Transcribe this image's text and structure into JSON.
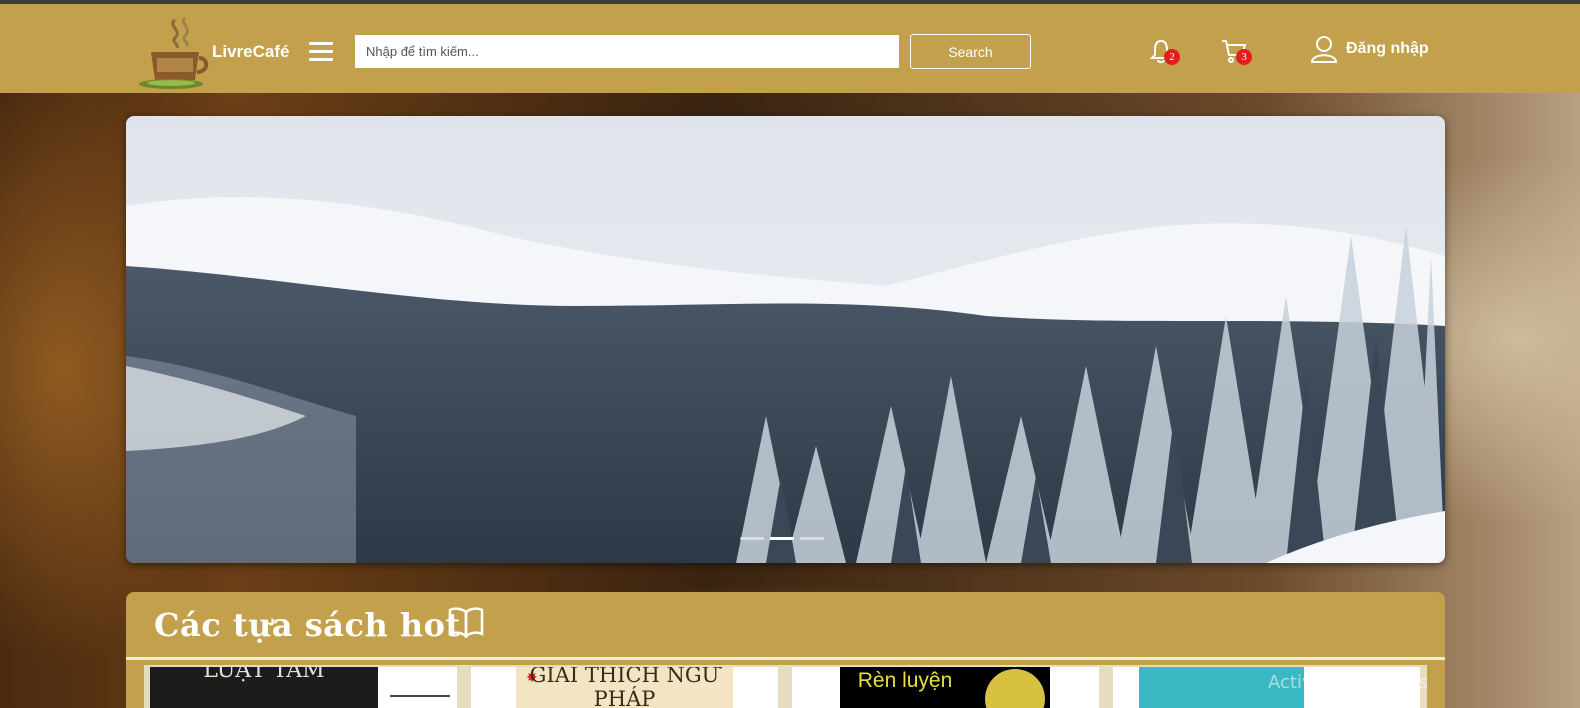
{
  "header": {
    "brand": "LivreCafé",
    "search_placeholder": "Nhập để tìm kiếm...",
    "search_button": "Search",
    "notification_count": "2",
    "cart_count": "3",
    "login_label": "Đăng nhập"
  },
  "carousel": {
    "slide_count": 3,
    "active_index": 1
  },
  "hot_books": {
    "title": "Các tựa sách hot",
    "books": [
      {
        "cover_text": "LUẬT TÂM"
      },
      {
        "cover_text": "GIẢI THÍCH NGỮ PHÁP"
      },
      {
        "cover_text": "Rèn luyện"
      },
      {
        "cover_text": ""
      }
    ]
  },
  "watermark": "Activate Windows",
  "colors": {
    "header_bg": "#c2a04c",
    "badge": "#e0201f"
  }
}
